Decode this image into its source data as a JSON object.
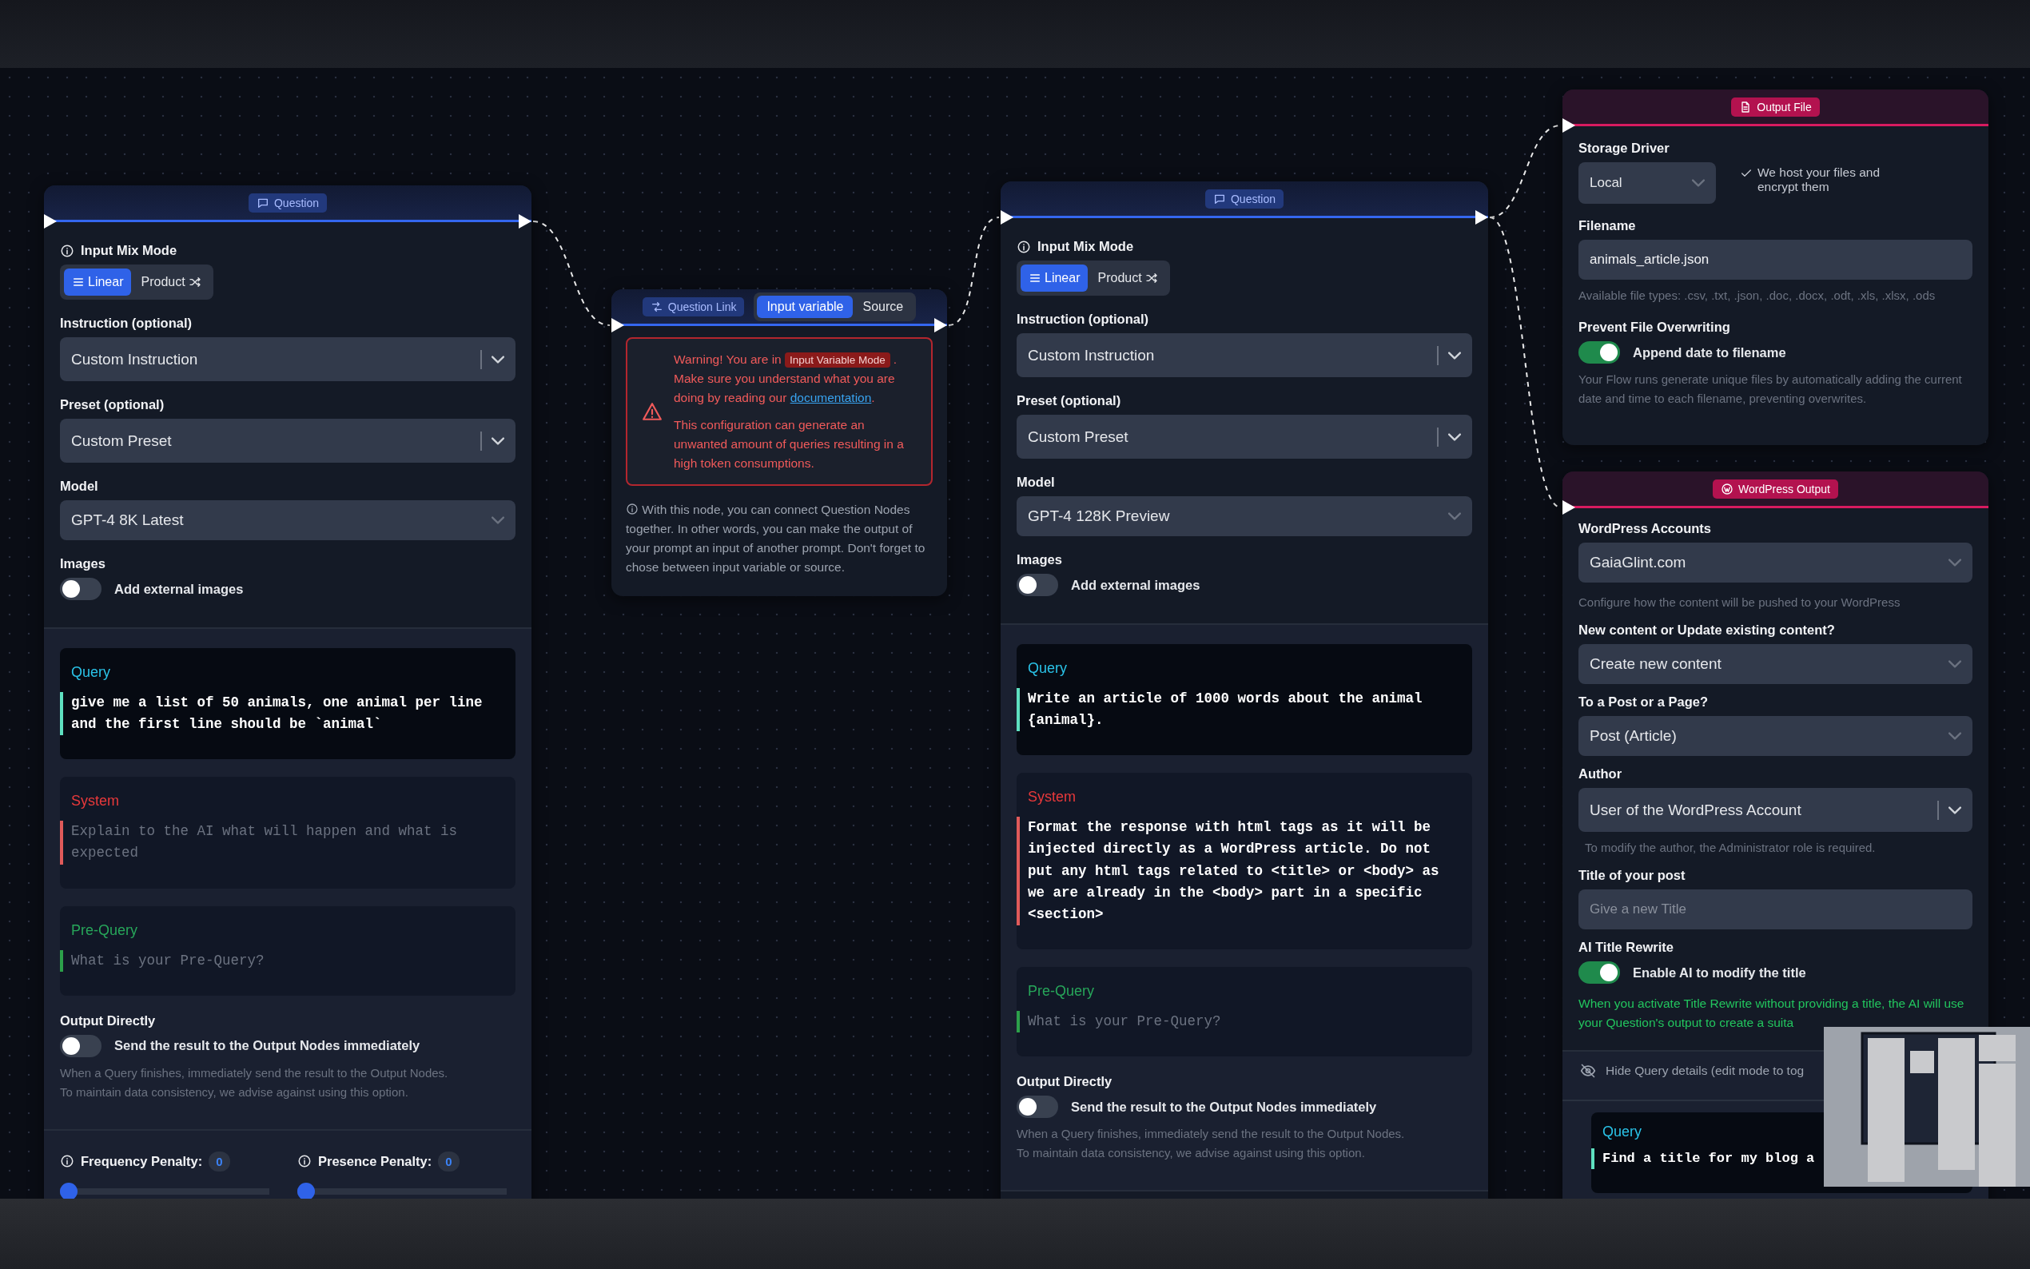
{
  "nodes": [
    {
      "kind": "question",
      "title": "Question",
      "has_input": true,
      "has_output": true,
      "sections": [
        {
          "items": [
            {
              "kind": "segmented",
              "label": "Input Mix Mode",
              "options": [
                {
                  "kind": "linear",
                  "label": "Linear",
                  "selected": true
                },
                {
                  "kind": "product",
                  "label": "Product",
                  "selected": false
                }
              ]
            },
            {
              "kind": "select",
              "label": "Instruction (optional)",
              "value": "Custom Instruction",
              "clearable": true
            },
            {
              "kind": "select",
              "label": "Preset (optional)",
              "value": "Custom Preset",
              "clearable": true
            },
            {
              "kind": "select",
              "label": "Model",
              "value": "GPT-4 8K Latest",
              "clearable": false
            },
            {
              "kind": "toggle",
              "label": "Images",
              "text": "Add external images",
              "on": false
            }
          ]
        },
        {
          "items": [
            {
              "kind": "query_prompt",
              "title": "Query",
              "text": "give me a list of 50 animals, one animal per line and the first line should be `animal`"
            },
            {
              "kind": "system_prompt",
              "title": "System",
              "placeholder": "Explain to the AI what will happen and what is expected"
            },
            {
              "kind": "pre_query_prompt",
              "title": "Pre-Query",
              "placeholder": "What is your Pre-Query?"
            },
            {
              "kind": "toggle",
              "label": "Output Directly",
              "text": "Send the result to the Output Nodes immediately",
              "on": false,
              "hint": "When a Query finishes, immediately send the result to the Output Nodes.\nTo maintain data consistency, we advise against using this option."
            }
          ]
        },
        {
          "items": [
            {
              "kind": "penalties",
              "penalties": [
                {
                  "label": "Frequency Penalty:",
                  "value": "0",
                  "level": 0
                },
                {
                  "label": "Presence Penalty:",
                  "value": "0",
                  "level": 0
                }
              ]
            }
          ]
        }
      ]
    },
    {
      "kind": "link",
      "title": "Question Link",
      "has_input": true,
      "has_output": true,
      "tabs": [
        {
          "label": "Input variable",
          "selected": true
        },
        {
          "label": "Source",
          "selected": false
        }
      ],
      "sections": [
        {
          "items": [
            {
              "kind": "warning",
              "lead": "Warning! You are in",
              "badge": "Input Variable Mode",
              "rest": ". Make sure you understand what you are doing by reading our",
              "link": "documentation",
              "end": ".",
              "detail": "This configuration can generate an unwanted amount of queries resulting in a high token consumptions."
            },
            {
              "kind": "info",
              "text": "With this node, you can connect Question Nodes together. In other words, you can make the output of your prompt an input of another prompt. Don't forget to chose between input variable or source."
            }
          ]
        }
      ]
    },
    {
      "kind": "question",
      "title": "Question",
      "has_input": true,
      "has_output": true,
      "sections": [
        {
          "items": [
            {
              "kind": "segmented",
              "label": "Input Mix Mode",
              "options": [
                {
                  "kind": "linear",
                  "label": "Linear",
                  "selected": true
                },
                {
                  "kind": "product",
                  "label": "Product",
                  "selected": false
                }
              ]
            },
            {
              "kind": "select",
              "label": "Instruction (optional)",
              "value": "Custom Instruction",
              "clearable": true
            },
            {
              "kind": "select",
              "label": "Preset (optional)",
              "value": "Custom Preset",
              "clearable": true
            },
            {
              "kind": "select",
              "label": "Model",
              "value": "GPT-4 128K Preview",
              "clearable": false
            },
            {
              "kind": "toggle",
              "label": "Images",
              "text": "Add external images",
              "on": false
            }
          ]
        },
        {
          "items": [
            {
              "kind": "query_prompt",
              "title": "Query",
              "text": "Write an article of 1000 words about the animal {animal}."
            },
            {
              "kind": "system_prompt",
              "title": "System",
              "text": "Format the response with html tags as it will be injected directly as a WordPress article. Do not put any html tags related to <title> or <body> as we are already in the <body> part in a specific <section>"
            },
            {
              "kind": "pre_query_prompt",
              "title": "Pre-Query",
              "placeholder": "What is your Pre-Query?"
            },
            {
              "kind": "toggle",
              "label": "Output Directly",
              "text": "Send the result to the Output Nodes immediately",
              "on": false,
              "hint": "When a Query finishes, immediately send the result to the Output Nodes.\nTo maintain data consistency, we advise against using this option."
            }
          ]
        }
      ]
    },
    {
      "kind": "output_file",
      "title": "Output File",
      "has_input": true,
      "sections": [
        {
          "items": [
            {
              "kind": "select_compact",
              "label": "Storage Driver",
              "value": "Local",
              "note": "We host your files and encrypt them"
            },
            {
              "kind": "input",
              "label": "Filename",
              "value": "animals_article.json",
              "hint": "Available file types: .csv, .txt, .json, .doc, .docx, .odt, .xls, .xlsx, .ods"
            },
            {
              "kind": "toggle",
              "label": "Prevent File Overwriting",
              "text": "Append date to filename",
              "on": true,
              "hint": "Your Flow runs generate unique files by automatically adding the current date and time to each filename, preventing overwrites."
            }
          ]
        }
      ]
    },
    {
      "kind": "wordpress",
      "title": "WordPress Output",
      "has_input": true,
      "sections": [
        {
          "items": [
            {
              "kind": "select",
              "label": "WordPress Accounts",
              "value": "GaiaGlint.com",
              "clearable": false
            },
            {
              "kind": "hint",
              "text": "Configure how the content will be pushed to your WordPress"
            },
            {
              "kind": "select",
              "label": "New content or Update existing content?",
              "value": "Create new content",
              "clearable": false
            },
            {
              "kind": "select",
              "label": "To a Post or a Page?",
              "value": "Post (Article)",
              "clearable": false
            },
            {
              "kind": "select",
              "label": "Author",
              "value": "User of the WordPress Account",
              "clearable": true,
              "hint": "To modify the author, the Administrator role is required."
            },
            {
              "kind": "input",
              "label": "Title of your post",
              "placeholder": "Give a new Title"
            },
            {
              "kind": "toggle",
              "label": "AI Title Rewrite",
              "text": "Enable AI to modify the title",
              "on": true
            },
            {
              "kind": "note",
              "text": "When you activate Title Rewrite without providing a title, the AI will use your Question's output to create a suita"
            }
          ]
        },
        {
          "items": [
            {
              "kind": "collapse_bar",
              "text": "Hide Query details (edit mode to tog"
            },
            {
              "kind": "query_prompt",
              "title": "Query",
              "text": "Find a title for my blog a"
            }
          ]
        }
      ]
    }
  ]
}
